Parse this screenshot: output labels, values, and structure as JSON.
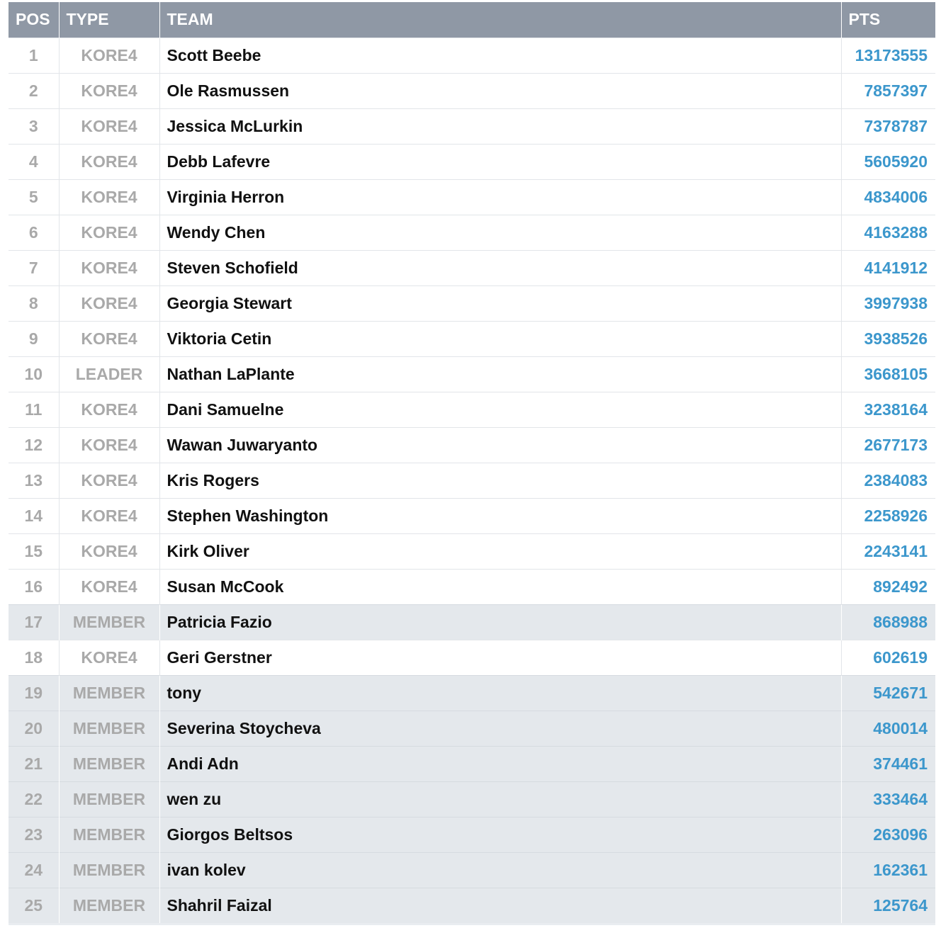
{
  "header": {
    "pos": "POS",
    "type": "TYPE",
    "team": "TEAM",
    "pts": "PTS"
  },
  "colors": {
    "header_bg": "#8f98a5",
    "member_row_bg": "#e4e8ec",
    "points_text": "#3c97cc",
    "muted_text": "#a9a9a9"
  },
  "rows": [
    {
      "pos": "1",
      "type": "KORE4",
      "team": "Scott Beebe",
      "pts": "13173555"
    },
    {
      "pos": "2",
      "type": "KORE4",
      "team": "Ole Rasmussen",
      "pts": "7857397"
    },
    {
      "pos": "3",
      "type": "KORE4",
      "team": "Jessica McLurkin",
      "pts": "7378787"
    },
    {
      "pos": "4",
      "type": "KORE4",
      "team": "Debb Lafevre",
      "pts": "5605920"
    },
    {
      "pos": "5",
      "type": "KORE4",
      "team": "Virginia Herron",
      "pts": "4834006"
    },
    {
      "pos": "6",
      "type": "KORE4",
      "team": "Wendy Chen",
      "pts": "4163288"
    },
    {
      "pos": "7",
      "type": "KORE4",
      "team": "Steven Schofield",
      "pts": "4141912"
    },
    {
      "pos": "8",
      "type": "KORE4",
      "team": "Georgia Stewart",
      "pts": "3997938"
    },
    {
      "pos": "9",
      "type": "KORE4",
      "team": "Viktoria Cetin",
      "pts": "3938526"
    },
    {
      "pos": "10",
      "type": "LEADER",
      "team": "Nathan LaPlante",
      "pts": "3668105"
    },
    {
      "pos": "11",
      "type": "KORE4",
      "team": "Dani Samuelne",
      "pts": "3238164"
    },
    {
      "pos": "12",
      "type": "KORE4",
      "team": "Wawan Juwaryanto",
      "pts": "2677173"
    },
    {
      "pos": "13",
      "type": "KORE4",
      "team": "Kris Rogers",
      "pts": "2384083"
    },
    {
      "pos": "14",
      "type": "KORE4",
      "team": "Stephen Washington",
      "pts": "2258926"
    },
    {
      "pos": "15",
      "type": "KORE4",
      "team": "Kirk Oliver",
      "pts": "2243141"
    },
    {
      "pos": "16",
      "type": "KORE4",
      "team": "Susan McCook",
      "pts": "892492"
    },
    {
      "pos": "17",
      "type": "MEMBER",
      "team": "Patricia Fazio",
      "pts": "868988"
    },
    {
      "pos": "18",
      "type": "KORE4",
      "team": "Geri Gerstner",
      "pts": "602619"
    },
    {
      "pos": "19",
      "type": "MEMBER",
      "team": "tony",
      "pts": "542671"
    },
    {
      "pos": "20",
      "type": "MEMBER",
      "team": "Severina Stoycheva",
      "pts": "480014"
    },
    {
      "pos": "21",
      "type": "MEMBER",
      "team": "Andi Adn",
      "pts": "374461"
    },
    {
      "pos": "22",
      "type": "MEMBER",
      "team": "wen zu",
      "pts": "333464"
    },
    {
      "pos": "23",
      "type": "MEMBER",
      "team": "Giorgos Beltsos",
      "pts": "263096"
    },
    {
      "pos": "24",
      "type": "MEMBER",
      "team": "ivan kolev",
      "pts": "162361"
    },
    {
      "pos": "25",
      "type": "MEMBER",
      "team": "Shahril Faizal",
      "pts": "125764"
    }
  ]
}
